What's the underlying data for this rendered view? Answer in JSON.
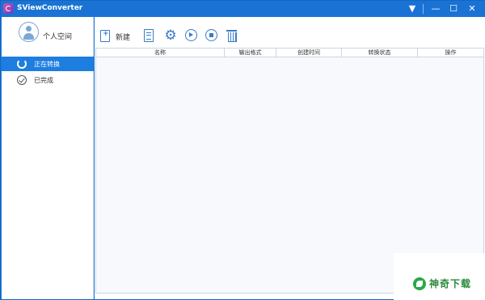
{
  "window": {
    "title": "SViewConverter",
    "controls": {
      "menu": "▼",
      "minimize": "—",
      "maximize": "☐",
      "close": "✕"
    }
  },
  "sidebar": {
    "profile_label": "个人空间",
    "items": [
      {
        "label": "正在转换",
        "icon": "converting-icon",
        "active": true
      },
      {
        "label": "已完成",
        "icon": "check-circle-icon",
        "active": false
      }
    ]
  },
  "toolbar": {
    "new_label": "新建",
    "gear_glyph": "⚙"
  },
  "table": {
    "columns": [
      "名称",
      "输出格式",
      "创建时间",
      "转换状态",
      "操作"
    ],
    "rows": []
  },
  "watermark": {
    "text": "神奇下载"
  },
  "colors": {
    "accent": "#1d7ee0",
    "titlebar": "#1a73d4",
    "icon": "#3a7bc8"
  }
}
